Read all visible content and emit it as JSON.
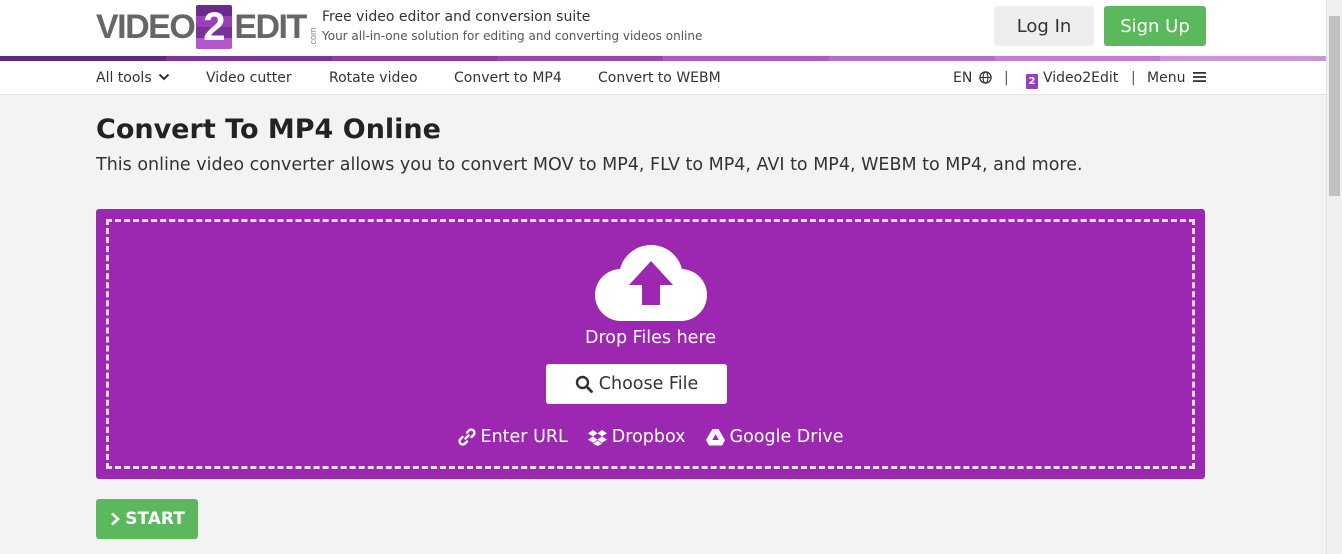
{
  "header": {
    "logo_left": "VIDEO",
    "logo_badge": "2",
    "logo_right": "EDIT",
    "logo_suffix": ".com",
    "tagline_title": "Free video editor and conversion suite",
    "tagline_sub": "Your all-in-one solution for editing and converting videos online",
    "login_label": "Log In",
    "signup_label": "Sign Up"
  },
  "nav": {
    "all_tools": "All tools",
    "items": [
      "Video cutter",
      "Rotate video",
      "Convert to MP4",
      "Convert to WEBM"
    ],
    "language": "EN",
    "separator": "|",
    "brand_badge": "2",
    "brand": "Video2Edit",
    "menu": "Menu"
  },
  "main": {
    "title": "Convert To MP4 Online",
    "description": "This online video converter allows you to convert MOV to MP4, FLV to MP4, AVI to MP4, WEBM to MP4, and more.",
    "drop_text": "Drop Files here",
    "choose_label": "Choose File",
    "sources": {
      "url": "Enter URL",
      "dropbox": "Dropbox",
      "gdrive": "Google Drive"
    },
    "start_label": "START"
  },
  "icons": {
    "globe": "globe-icon",
    "menu": "hamburger-icon",
    "upload": "cloud-upload-icon",
    "search": "search-icon",
    "link": "link-icon",
    "dropbox": "dropbox-icon",
    "gdrive": "google-drive-icon",
    "chevron_down": "chevron-down-icon",
    "chevron_right": "chevron-right-icon"
  },
  "colors": {
    "brand_purple": "#9c27b0",
    "success_green": "#5cb85c",
    "stripe": [
      "#5e2a7e",
      "#7b3496",
      "#8f3aa9",
      "#9b44b5",
      "#ab5bc2",
      "#b46ec9",
      "#c07fd0",
      "#cb95d8"
    ]
  }
}
